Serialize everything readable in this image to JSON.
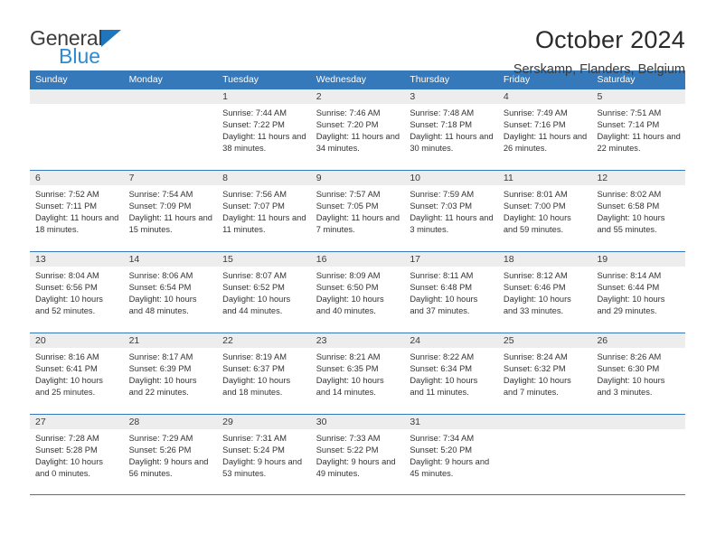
{
  "brand": {
    "name_part1": "General",
    "name_part2": "Blue",
    "accent_color": "#2e8ad4",
    "triangle_color": "#1f76bc"
  },
  "header": {
    "title": "October 2024",
    "subtitle": "Serskamp, Flanders, Belgium"
  },
  "calendar": {
    "header_color": "#3579bb",
    "day_band_color": "#ededed",
    "weekdays": [
      "Sunday",
      "Monday",
      "Tuesday",
      "Wednesday",
      "Thursday",
      "Friday",
      "Saturday"
    ],
    "weeks": [
      [
        {
          "empty": true
        },
        {
          "empty": true
        },
        {
          "day": "1",
          "sunrise": "Sunrise: 7:44 AM",
          "sunset": "Sunset: 7:22 PM",
          "daylight": "Daylight: 11 hours and 38 minutes."
        },
        {
          "day": "2",
          "sunrise": "Sunrise: 7:46 AM",
          "sunset": "Sunset: 7:20 PM",
          "daylight": "Daylight: 11 hours and 34 minutes."
        },
        {
          "day": "3",
          "sunrise": "Sunrise: 7:48 AM",
          "sunset": "Sunset: 7:18 PM",
          "daylight": "Daylight: 11 hours and 30 minutes."
        },
        {
          "day": "4",
          "sunrise": "Sunrise: 7:49 AM",
          "sunset": "Sunset: 7:16 PM",
          "daylight": "Daylight: 11 hours and 26 minutes."
        },
        {
          "day": "5",
          "sunrise": "Sunrise: 7:51 AM",
          "sunset": "Sunset: 7:14 PM",
          "daylight": "Daylight: 11 hours and 22 minutes."
        }
      ],
      [
        {
          "day": "6",
          "sunrise": "Sunrise: 7:52 AM",
          "sunset": "Sunset: 7:11 PM",
          "daylight": "Daylight: 11 hours and 18 minutes."
        },
        {
          "day": "7",
          "sunrise": "Sunrise: 7:54 AM",
          "sunset": "Sunset: 7:09 PM",
          "daylight": "Daylight: 11 hours and 15 minutes."
        },
        {
          "day": "8",
          "sunrise": "Sunrise: 7:56 AM",
          "sunset": "Sunset: 7:07 PM",
          "daylight": "Daylight: 11 hours and 11 minutes."
        },
        {
          "day": "9",
          "sunrise": "Sunrise: 7:57 AM",
          "sunset": "Sunset: 7:05 PM",
          "daylight": "Daylight: 11 hours and 7 minutes."
        },
        {
          "day": "10",
          "sunrise": "Sunrise: 7:59 AM",
          "sunset": "Sunset: 7:03 PM",
          "daylight": "Daylight: 11 hours and 3 minutes."
        },
        {
          "day": "11",
          "sunrise": "Sunrise: 8:01 AM",
          "sunset": "Sunset: 7:00 PM",
          "daylight": "Daylight: 10 hours and 59 minutes."
        },
        {
          "day": "12",
          "sunrise": "Sunrise: 8:02 AM",
          "sunset": "Sunset: 6:58 PM",
          "daylight": "Daylight: 10 hours and 55 minutes."
        }
      ],
      [
        {
          "day": "13",
          "sunrise": "Sunrise: 8:04 AM",
          "sunset": "Sunset: 6:56 PM",
          "daylight": "Daylight: 10 hours and 52 minutes."
        },
        {
          "day": "14",
          "sunrise": "Sunrise: 8:06 AM",
          "sunset": "Sunset: 6:54 PM",
          "daylight": "Daylight: 10 hours and 48 minutes."
        },
        {
          "day": "15",
          "sunrise": "Sunrise: 8:07 AM",
          "sunset": "Sunset: 6:52 PM",
          "daylight": "Daylight: 10 hours and 44 minutes."
        },
        {
          "day": "16",
          "sunrise": "Sunrise: 8:09 AM",
          "sunset": "Sunset: 6:50 PM",
          "daylight": "Daylight: 10 hours and 40 minutes."
        },
        {
          "day": "17",
          "sunrise": "Sunrise: 8:11 AM",
          "sunset": "Sunset: 6:48 PM",
          "daylight": "Daylight: 10 hours and 37 minutes."
        },
        {
          "day": "18",
          "sunrise": "Sunrise: 8:12 AM",
          "sunset": "Sunset: 6:46 PM",
          "daylight": "Daylight: 10 hours and 33 minutes."
        },
        {
          "day": "19",
          "sunrise": "Sunrise: 8:14 AM",
          "sunset": "Sunset: 6:44 PM",
          "daylight": "Daylight: 10 hours and 29 minutes."
        }
      ],
      [
        {
          "day": "20",
          "sunrise": "Sunrise: 8:16 AM",
          "sunset": "Sunset: 6:41 PM",
          "daylight": "Daylight: 10 hours and 25 minutes."
        },
        {
          "day": "21",
          "sunrise": "Sunrise: 8:17 AM",
          "sunset": "Sunset: 6:39 PM",
          "daylight": "Daylight: 10 hours and 22 minutes."
        },
        {
          "day": "22",
          "sunrise": "Sunrise: 8:19 AM",
          "sunset": "Sunset: 6:37 PM",
          "daylight": "Daylight: 10 hours and 18 minutes."
        },
        {
          "day": "23",
          "sunrise": "Sunrise: 8:21 AM",
          "sunset": "Sunset: 6:35 PM",
          "daylight": "Daylight: 10 hours and 14 minutes."
        },
        {
          "day": "24",
          "sunrise": "Sunrise: 8:22 AM",
          "sunset": "Sunset: 6:34 PM",
          "daylight": "Daylight: 10 hours and 11 minutes."
        },
        {
          "day": "25",
          "sunrise": "Sunrise: 8:24 AM",
          "sunset": "Sunset: 6:32 PM",
          "daylight": "Daylight: 10 hours and 7 minutes."
        },
        {
          "day": "26",
          "sunrise": "Sunrise: 8:26 AM",
          "sunset": "Sunset: 6:30 PM",
          "daylight": "Daylight: 10 hours and 3 minutes."
        }
      ],
      [
        {
          "day": "27",
          "sunrise": "Sunrise: 7:28 AM",
          "sunset": "Sunset: 5:28 PM",
          "daylight": "Daylight: 10 hours and 0 minutes."
        },
        {
          "day": "28",
          "sunrise": "Sunrise: 7:29 AM",
          "sunset": "Sunset: 5:26 PM",
          "daylight": "Daylight: 9 hours and 56 minutes."
        },
        {
          "day": "29",
          "sunrise": "Sunrise: 7:31 AM",
          "sunset": "Sunset: 5:24 PM",
          "daylight": "Daylight: 9 hours and 53 minutes."
        },
        {
          "day": "30",
          "sunrise": "Sunrise: 7:33 AM",
          "sunset": "Sunset: 5:22 PM",
          "daylight": "Daylight: 9 hours and 49 minutes."
        },
        {
          "day": "31",
          "sunrise": "Sunrise: 7:34 AM",
          "sunset": "Sunset: 5:20 PM",
          "daylight": "Daylight: 9 hours and 45 minutes."
        },
        {
          "empty": true
        },
        {
          "empty": true
        }
      ]
    ]
  }
}
